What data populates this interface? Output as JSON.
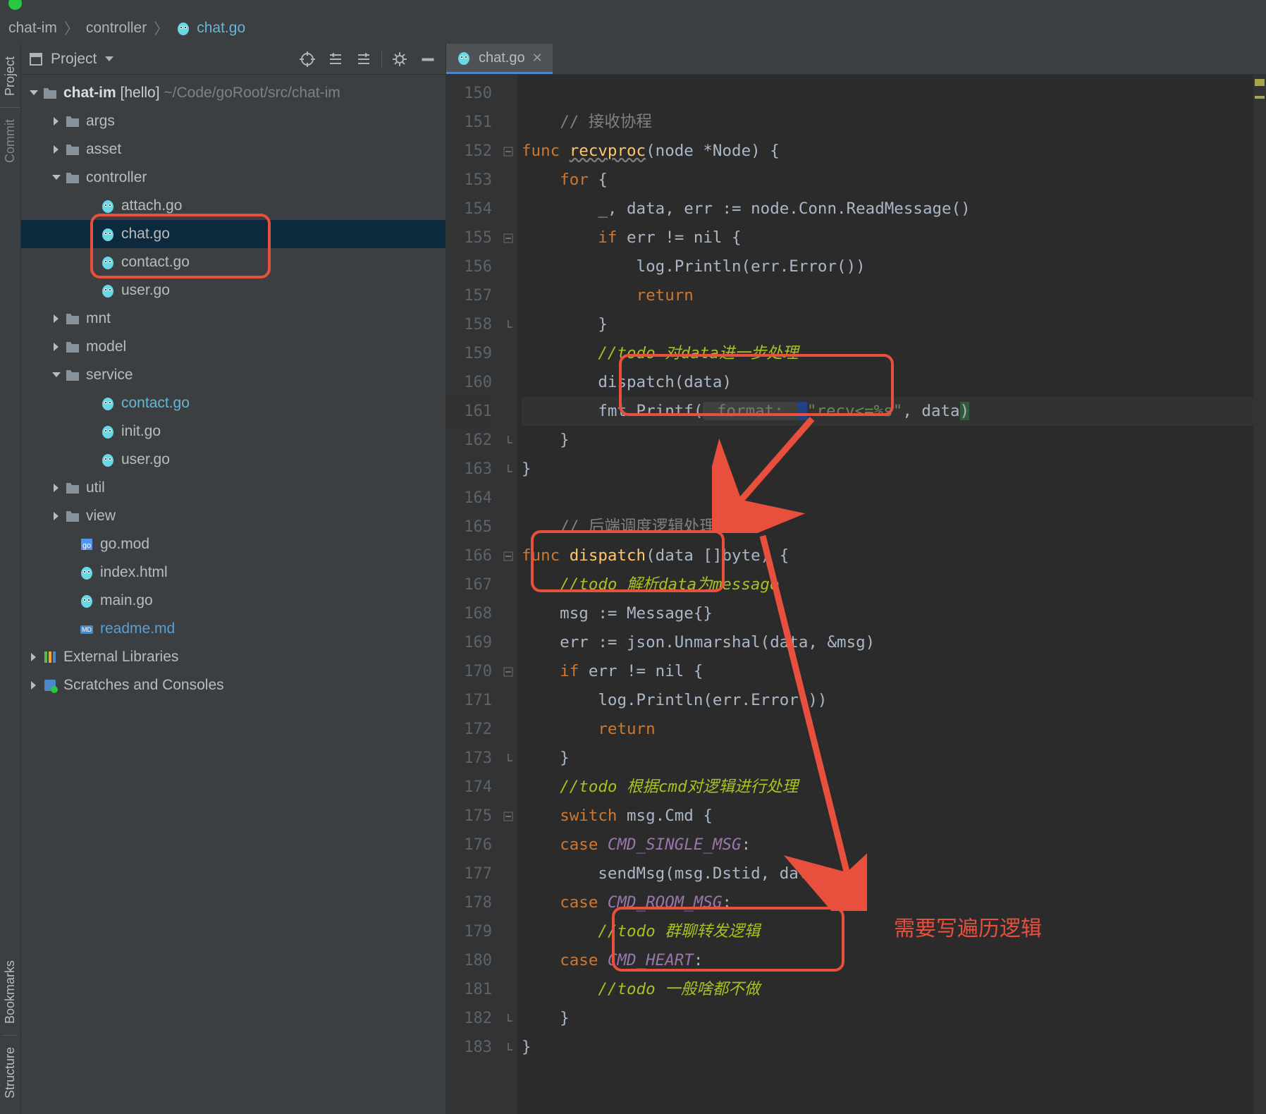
{
  "breadcrumb": {
    "p0": "chat-im",
    "p1": "controller",
    "p2": "chat.go"
  },
  "project": {
    "title": "Project",
    "root": {
      "name": "chat-im",
      "branch": "[hello]",
      "path": "~/Code/goRoot/src/chat-im"
    },
    "folders": {
      "args": "args",
      "asset": "asset",
      "controller": "controller",
      "mnt": "mnt",
      "model": "model",
      "service": "service",
      "util": "util",
      "view": "view"
    },
    "controllerFiles": {
      "attach": "attach.go",
      "chat": "chat.go",
      "contact": "contact.go",
      "user": "user.go"
    },
    "serviceFiles": {
      "contact": "contact.go",
      "init": "init.go",
      "user": "user.go"
    },
    "rootFiles": {
      "gomod": "go.mod",
      "index": "index.html",
      "main": "main.go",
      "readme": "readme.md"
    },
    "externals": "External Libraries",
    "scratches": "Scratches and Consoles"
  },
  "tab": {
    "name": "chat.go"
  },
  "gutter": {
    "start": 150,
    "end": 183
  },
  "code": {
    "l151": {
      "cmt": "// 接收协程"
    },
    "l152": {
      "kw": "func",
      "fn": "recvproc",
      "sig": "(node *Node) {"
    },
    "l153": {
      "kw": "for",
      "rest": " {"
    },
    "l154": "_, data, err := node.Conn.ReadMessage()",
    "l155": {
      "kw": "if",
      "rest": " err != nil {"
    },
    "l156": "log.Println(err.Error())",
    "l157": {
      "kw": "return"
    },
    "l158": "}",
    "l159": {
      "todo": "//todo 对data进一步处理"
    },
    "l160": "dispatch(data)",
    "l161": {
      "pre": "fmt.Printf(",
      "hint": " format: ",
      "str": "\"recv<=%s\"",
      "rest": ", data",
      "close": ")"
    },
    "l162": "}",
    "l163": "}",
    "l165": {
      "cmt": "// 后端调度逻辑处理"
    },
    "l166": {
      "kw": "func",
      "fn": "dispatch",
      "sig": "(data []byte) {"
    },
    "l167": {
      "todo": "//todo 解析data为message"
    },
    "l168": "msg := Message{}",
    "l169": "err := json.Unmarshal(data, &msg)",
    "l170": {
      "kw": "if",
      "rest": " err != nil {"
    },
    "l171": "log.Println(err.Error())",
    "l172": {
      "kw": "return"
    },
    "l173": "}",
    "l174": {
      "todo": "//todo 根据cmd对逻辑进行处理"
    },
    "l175": {
      "kw": "switch",
      "rest": " msg.Cmd {"
    },
    "l176": {
      "kw": "case",
      "const": "CMD_SINGLE_MSG",
      "rest": ":"
    },
    "l177": "sendMsg(msg.Dstid, data)",
    "l178": {
      "kw": "case",
      "const": "CMD_ROOM_MSG",
      "rest": ":"
    },
    "l179": {
      "todo": "//todo 群聊转发逻辑"
    },
    "l180": {
      "kw": "case",
      "const": "CMD_HEART",
      "rest": ":"
    },
    "l181": {
      "todo": "//todo 一般啥都不做"
    },
    "l182": "}",
    "l183": "}"
  },
  "annotations": {
    "rightText": "需要写遍历逻辑"
  },
  "sidebar": {
    "top": "Project",
    "commit": "Commit",
    "bookmarks": "Bookmarks",
    "structure": "Structure"
  }
}
